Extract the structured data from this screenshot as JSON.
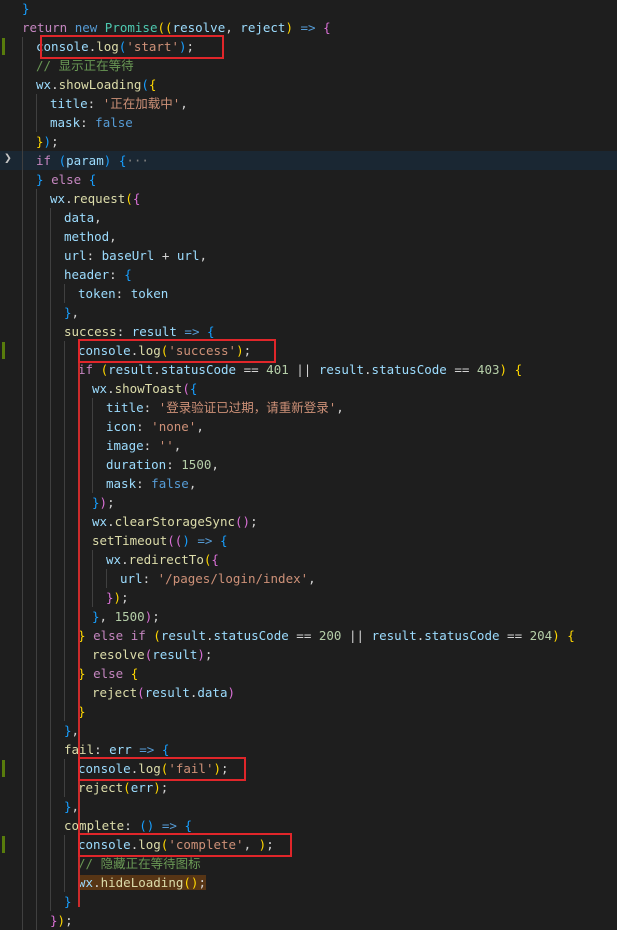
{
  "editor": {
    "language": "javascript",
    "theme_background": "#1e1e1e",
    "highlight_box_color": "#e0262a",
    "fold_collapsed_icon": "chevron-right-icon",
    "lines": [
      {
        "indent": 1,
        "tokens": [
          {
            "t": "}",
            "c": "b3"
          }
        ]
      },
      {
        "indent": 1,
        "tokens": [
          {
            "t": "return ",
            "c": "kw"
          },
          {
            "t": "new ",
            "c": "kw2"
          },
          {
            "t": "Promise",
            "c": "cls"
          },
          {
            "t": "((",
            "c": "b1"
          },
          {
            "t": "resolve",
            "c": "var"
          },
          {
            "t": ", ",
            "c": "p"
          },
          {
            "t": "reject",
            "c": "var"
          },
          {
            "t": ")",
            "c": "b1"
          },
          {
            "t": " => ",
            "c": "kw2"
          },
          {
            "t": "{",
            "c": "b2"
          }
        ]
      },
      {
        "indent": 2,
        "git": true,
        "box": true,
        "tokens": [
          {
            "t": "console",
            "c": "var"
          },
          {
            "t": ".",
            "c": "p"
          },
          {
            "t": "log",
            "c": "fn"
          },
          {
            "t": "(",
            "c": "b3"
          },
          {
            "t": "'start'",
            "c": "str"
          },
          {
            "t": ")",
            "c": "b3"
          },
          {
            "t": ";",
            "c": "p"
          }
        ]
      },
      {
        "indent": 2,
        "tokens": [
          {
            "t": "// 显示正在等待",
            "c": "cm"
          }
        ]
      },
      {
        "indent": 2,
        "tokens": [
          {
            "t": "wx",
            "c": "var"
          },
          {
            "t": ".",
            "c": "p"
          },
          {
            "t": "showLoading",
            "c": "fn"
          },
          {
            "t": "(",
            "c": "b3"
          },
          {
            "t": "{",
            "c": "b1"
          }
        ]
      },
      {
        "indent": 3,
        "tokens": [
          {
            "t": "title",
            "c": "var"
          },
          {
            "t": ": ",
            "c": "p"
          },
          {
            "t": "'正在加载中'",
            "c": "str"
          },
          {
            "t": ",",
            "c": "p"
          }
        ]
      },
      {
        "indent": 3,
        "tokens": [
          {
            "t": "mask",
            "c": "var"
          },
          {
            "t": ": ",
            "c": "p"
          },
          {
            "t": "false",
            "c": "kw2"
          }
        ]
      },
      {
        "indent": 2,
        "tokens": [
          {
            "t": "}",
            "c": "b1"
          },
          {
            "t": ")",
            "c": "b3"
          },
          {
            "t": ";",
            "c": "p"
          }
        ]
      },
      {
        "indent": 2,
        "folded": true,
        "hl": true,
        "tokens": [
          {
            "t": "if ",
            "c": "kw"
          },
          {
            "t": "(",
            "c": "b3"
          },
          {
            "t": "param",
            "c": "var"
          },
          {
            "t": ")",
            "c": "b3"
          },
          {
            "t": " ",
            "c": "p"
          },
          {
            "t": "{",
            "c": "b3"
          },
          {
            "t": "···",
            "c": "fold"
          }
        ]
      },
      {
        "indent": 2,
        "tokens": [
          {
            "t": "} ",
            "c": "b3"
          },
          {
            "t": "else ",
            "c": "kw"
          },
          {
            "t": "{",
            "c": "b3"
          }
        ]
      },
      {
        "indent": 3,
        "tokens": [
          {
            "t": "wx",
            "c": "var"
          },
          {
            "t": ".",
            "c": "p"
          },
          {
            "t": "request",
            "c": "fn"
          },
          {
            "t": "(",
            "c": "b1"
          },
          {
            "t": "{",
            "c": "b2"
          }
        ]
      },
      {
        "indent": 4,
        "tokens": [
          {
            "t": "data",
            "c": "var"
          },
          {
            "t": ",",
            "c": "p"
          }
        ]
      },
      {
        "indent": 4,
        "tokens": [
          {
            "t": "method",
            "c": "var"
          },
          {
            "t": ",",
            "c": "p"
          }
        ]
      },
      {
        "indent": 4,
        "tokens": [
          {
            "t": "url",
            "c": "var"
          },
          {
            "t": ": ",
            "c": "p"
          },
          {
            "t": "baseUrl",
            "c": "var"
          },
          {
            "t": " + ",
            "c": "p"
          },
          {
            "t": "url",
            "c": "var"
          },
          {
            "t": ",",
            "c": "p"
          }
        ]
      },
      {
        "indent": 4,
        "tokens": [
          {
            "t": "header",
            "c": "var"
          },
          {
            "t": ": ",
            "c": "p"
          },
          {
            "t": "{",
            "c": "b3"
          }
        ]
      },
      {
        "indent": 5,
        "tokens": [
          {
            "t": "token",
            "c": "var"
          },
          {
            "t": ": ",
            "c": "p"
          },
          {
            "t": "token",
            "c": "var"
          }
        ]
      },
      {
        "indent": 4,
        "tokens": [
          {
            "t": "}",
            "c": "b3"
          },
          {
            "t": ",",
            "c": "p"
          }
        ]
      },
      {
        "indent": 4,
        "tokens": [
          {
            "t": "success",
            "c": "fn"
          },
          {
            "t": ": ",
            "c": "p"
          },
          {
            "t": "result",
            "c": "var"
          },
          {
            "t": " => ",
            "c": "kw2"
          },
          {
            "t": "{",
            "c": "b3"
          }
        ]
      },
      {
        "indent": 5,
        "git": true,
        "box": true,
        "tokens": [
          {
            "t": "console",
            "c": "var"
          },
          {
            "t": ".",
            "c": "p"
          },
          {
            "t": "log",
            "c": "fn"
          },
          {
            "t": "(",
            "c": "b1"
          },
          {
            "t": "'success'",
            "c": "str"
          },
          {
            "t": ")",
            "c": "b1"
          },
          {
            "t": ";",
            "c": "p"
          }
        ]
      },
      {
        "indent": 5,
        "tokens": [
          {
            "t": "if ",
            "c": "kw"
          },
          {
            "t": "(",
            "c": "b1"
          },
          {
            "t": "result",
            "c": "var"
          },
          {
            "t": ".",
            "c": "p"
          },
          {
            "t": "statusCode",
            "c": "var"
          },
          {
            "t": " == ",
            "c": "p"
          },
          {
            "t": "401",
            "c": "num"
          },
          {
            "t": " || ",
            "c": "p"
          },
          {
            "t": "result",
            "c": "var"
          },
          {
            "t": ".",
            "c": "p"
          },
          {
            "t": "statusCode",
            "c": "var"
          },
          {
            "t": " == ",
            "c": "p"
          },
          {
            "t": "403",
            "c": "num"
          },
          {
            "t": ")",
            "c": "b1"
          },
          {
            "t": " ",
            "c": "p"
          },
          {
            "t": "{",
            "c": "b1"
          }
        ]
      },
      {
        "indent": 6,
        "tokens": [
          {
            "t": "wx",
            "c": "var"
          },
          {
            "t": ".",
            "c": "p"
          },
          {
            "t": "showToast",
            "c": "fn"
          },
          {
            "t": "(",
            "c": "b2"
          },
          {
            "t": "{",
            "c": "b3"
          }
        ]
      },
      {
        "indent": 7,
        "tokens": [
          {
            "t": "title",
            "c": "var"
          },
          {
            "t": ": ",
            "c": "p"
          },
          {
            "t": "'登录验证已过期，请重新登录'",
            "c": "str"
          },
          {
            "t": ",",
            "c": "p"
          }
        ]
      },
      {
        "indent": 7,
        "tokens": [
          {
            "t": "icon",
            "c": "var"
          },
          {
            "t": ": ",
            "c": "p"
          },
          {
            "t": "'none'",
            "c": "str"
          },
          {
            "t": ",",
            "c": "p"
          }
        ]
      },
      {
        "indent": 7,
        "tokens": [
          {
            "t": "image",
            "c": "var"
          },
          {
            "t": ": ",
            "c": "p"
          },
          {
            "t": "''",
            "c": "str"
          },
          {
            "t": ",",
            "c": "p"
          }
        ]
      },
      {
        "indent": 7,
        "tokens": [
          {
            "t": "duration",
            "c": "var"
          },
          {
            "t": ": ",
            "c": "p"
          },
          {
            "t": "1500",
            "c": "num"
          },
          {
            "t": ",",
            "c": "p"
          }
        ]
      },
      {
        "indent": 7,
        "tokens": [
          {
            "t": "mask",
            "c": "var"
          },
          {
            "t": ": ",
            "c": "p"
          },
          {
            "t": "false",
            "c": "kw2"
          },
          {
            "t": ",",
            "c": "p"
          }
        ]
      },
      {
        "indent": 6,
        "tokens": [
          {
            "t": "}",
            "c": "b3"
          },
          {
            "t": ")",
            "c": "b2"
          },
          {
            "t": ";",
            "c": "p"
          }
        ]
      },
      {
        "indent": 6,
        "tokens": [
          {
            "t": "wx",
            "c": "var"
          },
          {
            "t": ".",
            "c": "p"
          },
          {
            "t": "clearStorageSync",
            "c": "fn"
          },
          {
            "t": "()",
            "c": "b2"
          },
          {
            "t": ";",
            "c": "p"
          }
        ]
      },
      {
        "indent": 6,
        "tokens": [
          {
            "t": "setTimeout",
            "c": "fn"
          },
          {
            "t": "((",
            "c": "b2"
          },
          {
            "t": ")",
            "c": "b3"
          },
          {
            "t": " => ",
            "c": "kw2"
          },
          {
            "t": "{",
            "c": "b3"
          }
        ]
      },
      {
        "indent": 7,
        "tokens": [
          {
            "t": "wx",
            "c": "var"
          },
          {
            "t": ".",
            "c": "p"
          },
          {
            "t": "redirectTo",
            "c": "fn"
          },
          {
            "t": "(",
            "c": "b1"
          },
          {
            "t": "{",
            "c": "b2"
          }
        ]
      },
      {
        "indent": 8,
        "tokens": [
          {
            "t": "url",
            "c": "var"
          },
          {
            "t": ": ",
            "c": "p"
          },
          {
            "t": "'/pages/login/index'",
            "c": "str"
          },
          {
            "t": ",",
            "c": "p"
          }
        ]
      },
      {
        "indent": 7,
        "tokens": [
          {
            "t": "}",
            "c": "b2"
          },
          {
            "t": ")",
            "c": "b1"
          },
          {
            "t": ";",
            "c": "p"
          }
        ]
      },
      {
        "indent": 6,
        "tokens": [
          {
            "t": "}",
            "c": "b3"
          },
          {
            "t": ", ",
            "c": "p"
          },
          {
            "t": "1500",
            "c": "num"
          },
          {
            "t": ")",
            "c": "b2"
          },
          {
            "t": ";",
            "c": "p"
          }
        ]
      },
      {
        "indent": 5,
        "tokens": [
          {
            "t": "} ",
            "c": "b1"
          },
          {
            "t": "else if ",
            "c": "kw"
          },
          {
            "t": "(",
            "c": "b1"
          },
          {
            "t": "result",
            "c": "var"
          },
          {
            "t": ".",
            "c": "p"
          },
          {
            "t": "statusCode",
            "c": "var"
          },
          {
            "t": " == ",
            "c": "p"
          },
          {
            "t": "200",
            "c": "num"
          },
          {
            "t": " || ",
            "c": "p"
          },
          {
            "t": "result",
            "c": "var"
          },
          {
            "t": ".",
            "c": "p"
          },
          {
            "t": "statusCode",
            "c": "var"
          },
          {
            "t": " == ",
            "c": "p"
          },
          {
            "t": "204",
            "c": "num"
          },
          {
            "t": ")",
            "c": "b1"
          },
          {
            "t": " ",
            "c": "p"
          },
          {
            "t": "{",
            "c": "b1"
          }
        ]
      },
      {
        "indent": 6,
        "tokens": [
          {
            "t": "resolve",
            "c": "fn"
          },
          {
            "t": "(",
            "c": "b2"
          },
          {
            "t": "result",
            "c": "var"
          },
          {
            "t": ")",
            "c": "b2"
          },
          {
            "t": ";",
            "c": "p"
          }
        ]
      },
      {
        "indent": 5,
        "tokens": [
          {
            "t": "} ",
            "c": "b1"
          },
          {
            "t": "else ",
            "c": "kw"
          },
          {
            "t": "{",
            "c": "b1"
          }
        ]
      },
      {
        "indent": 6,
        "tokens": [
          {
            "t": "reject",
            "c": "fn"
          },
          {
            "t": "(",
            "c": "b2"
          },
          {
            "t": "result",
            "c": "var"
          },
          {
            "t": ".",
            "c": "p"
          },
          {
            "t": "data",
            "c": "var"
          },
          {
            "t": ")",
            "c": "b2"
          }
        ]
      },
      {
        "indent": 5,
        "tokens": [
          {
            "t": "}",
            "c": "b1"
          }
        ]
      },
      {
        "indent": 4,
        "tokens": [
          {
            "t": "}",
            "c": "b3"
          },
          {
            "t": ",",
            "c": "p"
          }
        ]
      },
      {
        "indent": 4,
        "tokens": [
          {
            "t": "fail",
            "c": "fn"
          },
          {
            "t": ": ",
            "c": "p"
          },
          {
            "t": "err",
            "c": "var"
          },
          {
            "t": " => ",
            "c": "kw2"
          },
          {
            "t": "{",
            "c": "b3"
          }
        ]
      },
      {
        "indent": 5,
        "git": true,
        "box": true,
        "tokens": [
          {
            "t": "console",
            "c": "var"
          },
          {
            "t": ".",
            "c": "p"
          },
          {
            "t": "log",
            "c": "fn"
          },
          {
            "t": "(",
            "c": "b1"
          },
          {
            "t": "'fail'",
            "c": "str"
          },
          {
            "t": ")",
            "c": "b1"
          },
          {
            "t": ";",
            "c": "p"
          }
        ]
      },
      {
        "indent": 5,
        "tokens": [
          {
            "t": "reject",
            "c": "fn"
          },
          {
            "t": "(",
            "c": "b1"
          },
          {
            "t": "err",
            "c": "var"
          },
          {
            "t": ")",
            "c": "b1"
          },
          {
            "t": ";",
            "c": "p"
          }
        ]
      },
      {
        "indent": 4,
        "tokens": [
          {
            "t": "}",
            "c": "b3"
          },
          {
            "t": ",",
            "c": "p"
          }
        ]
      },
      {
        "indent": 4,
        "tokens": [
          {
            "t": "complete",
            "c": "fn"
          },
          {
            "t": ": ",
            "c": "p"
          },
          {
            "t": "()",
            "c": "b3"
          },
          {
            "t": " => ",
            "c": "kw2"
          },
          {
            "t": "{",
            "c": "b3"
          }
        ]
      },
      {
        "indent": 5,
        "git": true,
        "box": true,
        "tokens": [
          {
            "t": "console",
            "c": "var"
          },
          {
            "t": ".",
            "c": "p"
          },
          {
            "t": "log",
            "c": "fn"
          },
          {
            "t": "(",
            "c": "b1"
          },
          {
            "t": "'complete'",
            "c": "str"
          },
          {
            "t": ", ",
            "c": "p"
          },
          {
            "t": ")",
            "c": "b1"
          },
          {
            "t": ";",
            "c": "p"
          }
        ]
      },
      {
        "indent": 5,
        "tokens": [
          {
            "t": "// 隐藏正在等待图标",
            "c": "cm"
          }
        ]
      },
      {
        "indent": 5,
        "tokens": [
          {
            "t": "wx",
            "c": "var",
            "sel": true
          },
          {
            "t": ".",
            "c": "p",
            "sel": true
          },
          {
            "t": "hideLoading",
            "c": "fn",
            "sel": true
          },
          {
            "t": "()",
            "c": "b1",
            "sel": true
          },
          {
            "t": ";",
            "c": "p",
            "sel": true
          }
        ]
      },
      {
        "indent": 4,
        "tokens": [
          {
            "t": "}",
            "c": "b3"
          }
        ]
      },
      {
        "indent": 3,
        "tokens": [
          {
            "t": "}",
            "c": "b2"
          },
          {
            "t": ")",
            "c": "b1"
          },
          {
            "t": ";",
            "c": "p"
          }
        ]
      }
    ]
  }
}
